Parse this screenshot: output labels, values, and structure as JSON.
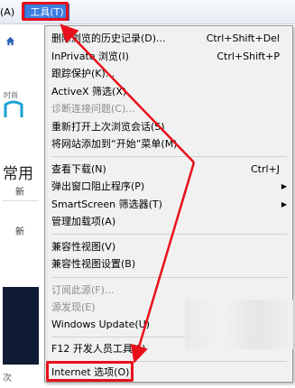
{
  "menubar": {
    "prev_item": "(A)",
    "tools": "工具(T)"
  },
  "background": {
    "link_text": "",
    "small_label": "时尚",
    "heading": "常用",
    "mini1": "新",
    "mini2": "新",
    "footer_text": "次"
  },
  "menu": {
    "items": [
      {
        "label": "删除浏览的历史记录(D)...",
        "shortcut": "Ctrl+Shift+Del"
      },
      {
        "label": "InPrivate 浏览(I)",
        "shortcut": "Ctrl+Shift+P"
      },
      {
        "label": "跟踪保护(K)...",
        "shortcut": ""
      },
      {
        "label": "ActiveX 筛选(X)",
        "shortcut": ""
      },
      {
        "label": "诊断连接问题(C)...",
        "shortcut": ""
      },
      {
        "label": "重新打开上次浏览会话(S)",
        "shortcut": ""
      },
      {
        "label": "将网站添加到“开始”菜单(M)",
        "shortcut": ""
      },
      {
        "label": "查看下载(N)",
        "shortcut": "Ctrl+J"
      },
      {
        "label": "弹出窗口阻止程序(P)",
        "shortcut": ""
      },
      {
        "label": "SmartScreen 筛选器(T)",
        "shortcut": ""
      },
      {
        "label": "管理加载项(A)",
        "shortcut": ""
      },
      {
        "label": "兼容性视图(V)",
        "shortcut": ""
      },
      {
        "label": "兼容性视图设置(B)",
        "shortcut": ""
      },
      {
        "label": "订阅此源(F)...",
        "shortcut": ""
      },
      {
        "label": "源发现(E)",
        "shortcut": ""
      },
      {
        "label": "Windows Update(U)",
        "shortcut": ""
      },
      {
        "label": "F12 开发人员工具(L)",
        "shortcut": ""
      },
      {
        "label": "Internet 选项(O)",
        "shortcut": ""
      }
    ]
  },
  "colors": {
    "annotation": "#e8101a",
    "highlight": "#3b7ee0"
  }
}
